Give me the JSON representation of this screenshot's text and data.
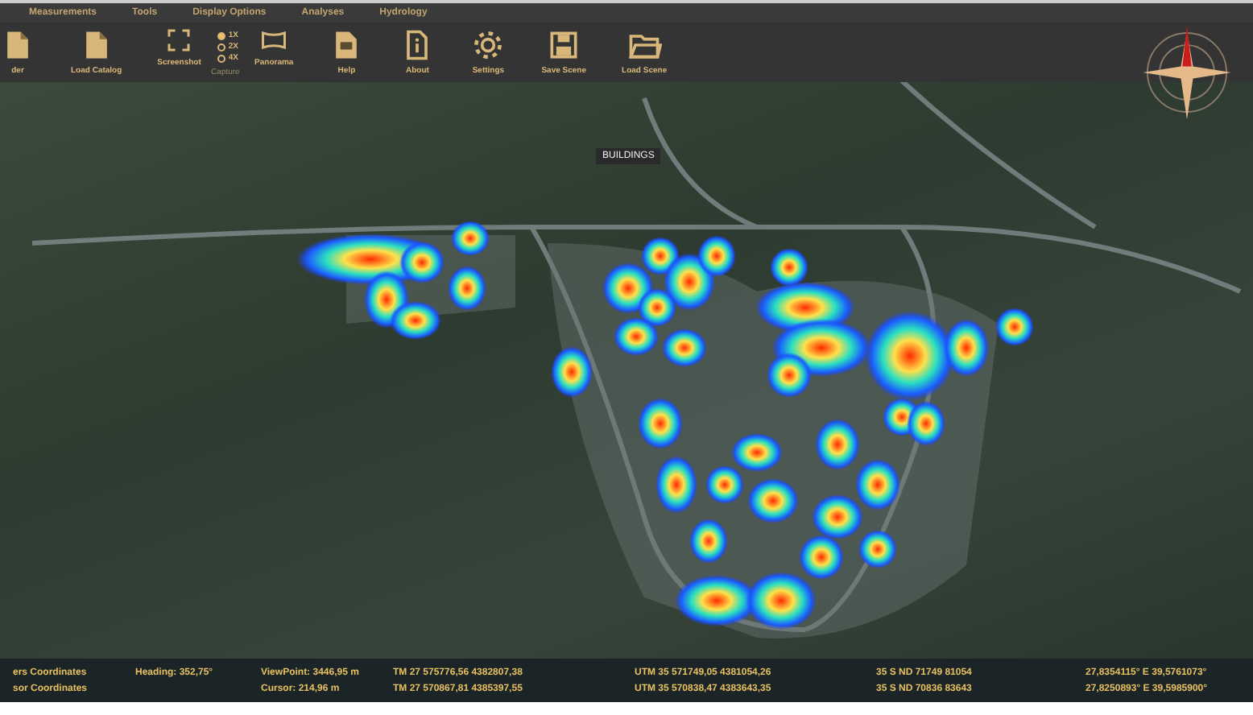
{
  "menu": [
    {
      "label": "Measurements"
    },
    {
      "label": "Tools"
    },
    {
      "label": "Display Options"
    },
    {
      "label": "Analyses"
    },
    {
      "label": "Hydrology"
    }
  ],
  "toolbar": [
    {
      "kind": "button",
      "label": "der"
    },
    {
      "kind": "button",
      "label": "Load Catalog"
    },
    {
      "kind": "capture",
      "label": "Capture",
      "items": [
        {
          "kind": "button",
          "label": "Screenshot"
        },
        {
          "kind": "radios",
          "options": [
            {
              "label": "1X",
              "selected": true
            },
            {
              "label": "2X",
              "selected": false
            },
            {
              "label": "4X",
              "selected": false
            }
          ]
        },
        {
          "kind": "button",
          "label": "Panorama"
        }
      ]
    },
    {
      "kind": "button",
      "label": "Help"
    },
    {
      "kind": "button",
      "label": "About"
    },
    {
      "kind": "button",
      "label": "Settings"
    },
    {
      "kind": "button",
      "label": "Save Scene"
    },
    {
      "kind": "button",
      "label": "Load Scene"
    }
  ],
  "map": {
    "label": "BUILDINGS"
  },
  "status_rows": [
    {
      "label": "ers Coordinates",
      "heading": "Heading: 352,75°",
      "distance": "ViewPoint: 3446,95 m",
      "tm": "TM 27 575776,56 4382807,38",
      "utm": "UTM 35 571749,05 4381054,26",
      "mgrs": "35 S ND 71749 81054",
      "geo": "27,8354115° E 39,5761073°"
    },
    {
      "label": "sor Coordinates",
      "distance": "Cursor: 214,96 m",
      "tm": "TM 27 570867,81 4385397,55",
      "utm": "UTM 35 570838,47 4383643,35",
      "mgrs": "35 S ND 70836 83643",
      "geo": "27,8250893° E 39,5985900°"
    }
  ]
}
